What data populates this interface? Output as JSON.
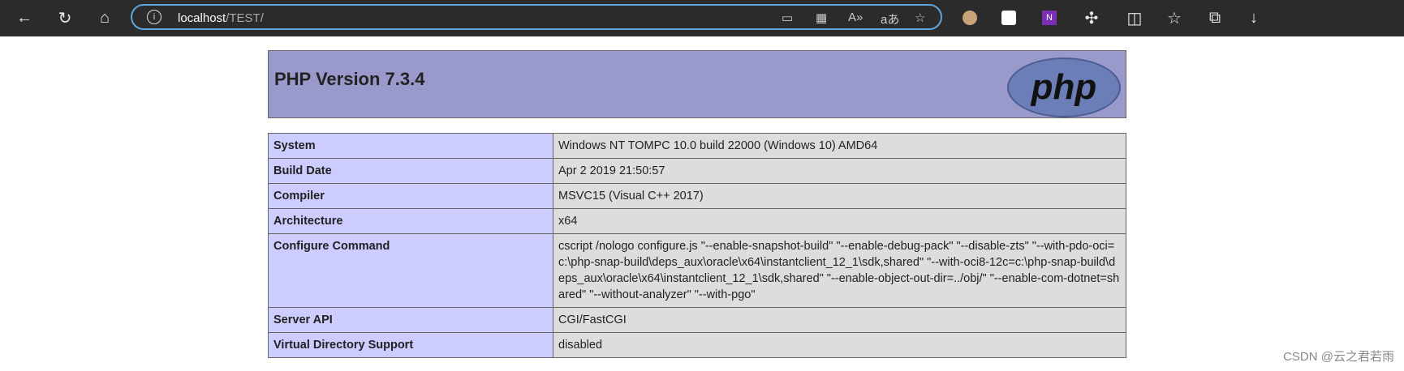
{
  "browser": {
    "url_host": "localhost",
    "url_path": "/TEST/"
  },
  "header": {
    "title": "PHP Version 7.3.4",
    "logo_text": "php"
  },
  "rows": [
    {
      "label": "System",
      "value": "Windows NT TOMPC 10.0 build 22000 (Windows 10) AMD64"
    },
    {
      "label": "Build Date",
      "value": "Apr 2 2019 21:50:57"
    },
    {
      "label": "Compiler",
      "value": "MSVC15 (Visual C++ 2017)"
    },
    {
      "label": "Architecture",
      "value": "x64"
    },
    {
      "label": "Configure Command",
      "value": "cscript /nologo configure.js \"--enable-snapshot-build\" \"--enable-debug-pack\" \"--disable-zts\" \"--with-pdo-oci=c:\\php-snap-build\\deps_aux\\oracle\\x64\\instantclient_12_1\\sdk,shared\" \"--with-oci8-12c=c:\\php-snap-build\\deps_aux\\oracle\\x64\\instantclient_12_1\\sdk,shared\" \"--enable-object-out-dir=../obj/\" \"--enable-com-dotnet=shared\" \"--without-analyzer\" \"--with-pgo\""
    },
    {
      "label": "Server API",
      "value": "CGI/FastCGI"
    },
    {
      "label": "Virtual Directory Support",
      "value": "disabled"
    }
  ],
  "watermark": "CSDN @云之君若雨"
}
